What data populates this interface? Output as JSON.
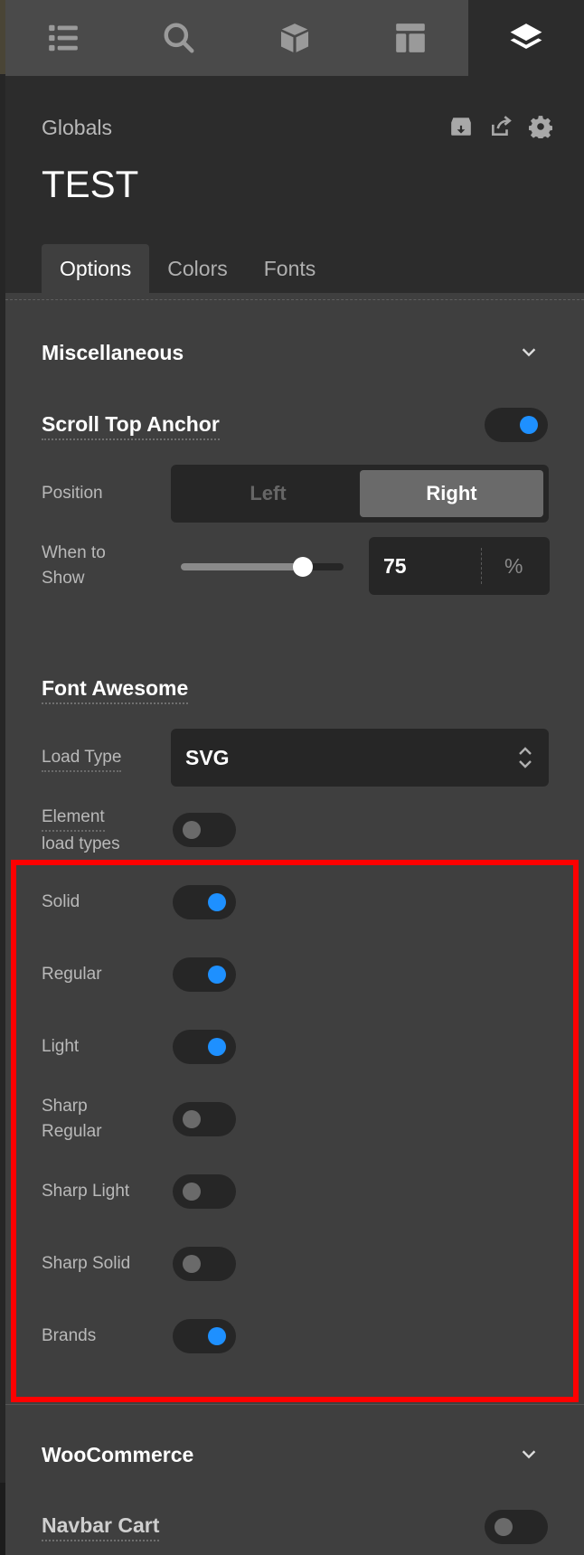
{
  "topbar": {
    "icons": [
      "list-icon",
      "search-icon",
      "cube-icon",
      "layout-icon",
      "layers-icon"
    ],
    "active": "layers-icon"
  },
  "header": {
    "section": "Globals",
    "title": "TEST",
    "icons": [
      "archive-download-icon",
      "share-icon",
      "gear-icon"
    ],
    "tabs": [
      {
        "label": "Options",
        "active": true
      },
      {
        "label": "Colors",
        "active": false
      },
      {
        "label": "Fonts",
        "active": false
      }
    ]
  },
  "misc": {
    "title": "Miscellaneous",
    "scroll_top": {
      "label": "Scroll Top Anchor",
      "on": true
    },
    "position": {
      "label": "Position",
      "options": [
        "Left",
        "Right"
      ],
      "selected": "Right"
    },
    "when_to_show": {
      "label_line1": "When to",
      "label_line2": "Show",
      "value": "75",
      "unit": "%",
      "slider_fraction": 0.75
    }
  },
  "font_awesome": {
    "title": "Font Awesome",
    "load_type": {
      "label": "Load Type",
      "value": "SVG"
    },
    "element_load_types": {
      "label_line1": "Element",
      "label_line2": "load types",
      "on": false
    },
    "types": [
      {
        "label": "Solid",
        "on": true
      },
      {
        "label": "Regular",
        "on": true
      },
      {
        "label": "Light",
        "on": true
      },
      {
        "label_line1": "Sharp",
        "label_line2": "Regular",
        "on": false
      },
      {
        "label": "Sharp Light",
        "on": false
      },
      {
        "label": "Sharp Solid",
        "on": false
      },
      {
        "label": "Brands",
        "on": true
      }
    ]
  },
  "woocommerce": {
    "title": "WooCommerce",
    "navbar_cart": {
      "label": "Navbar Cart",
      "on": false
    }
  },
  "colors": {
    "accent": "#1e90ff",
    "highlight": "#ff0000",
    "panel": "#3f3f3f",
    "header": "#2c2c2c"
  }
}
